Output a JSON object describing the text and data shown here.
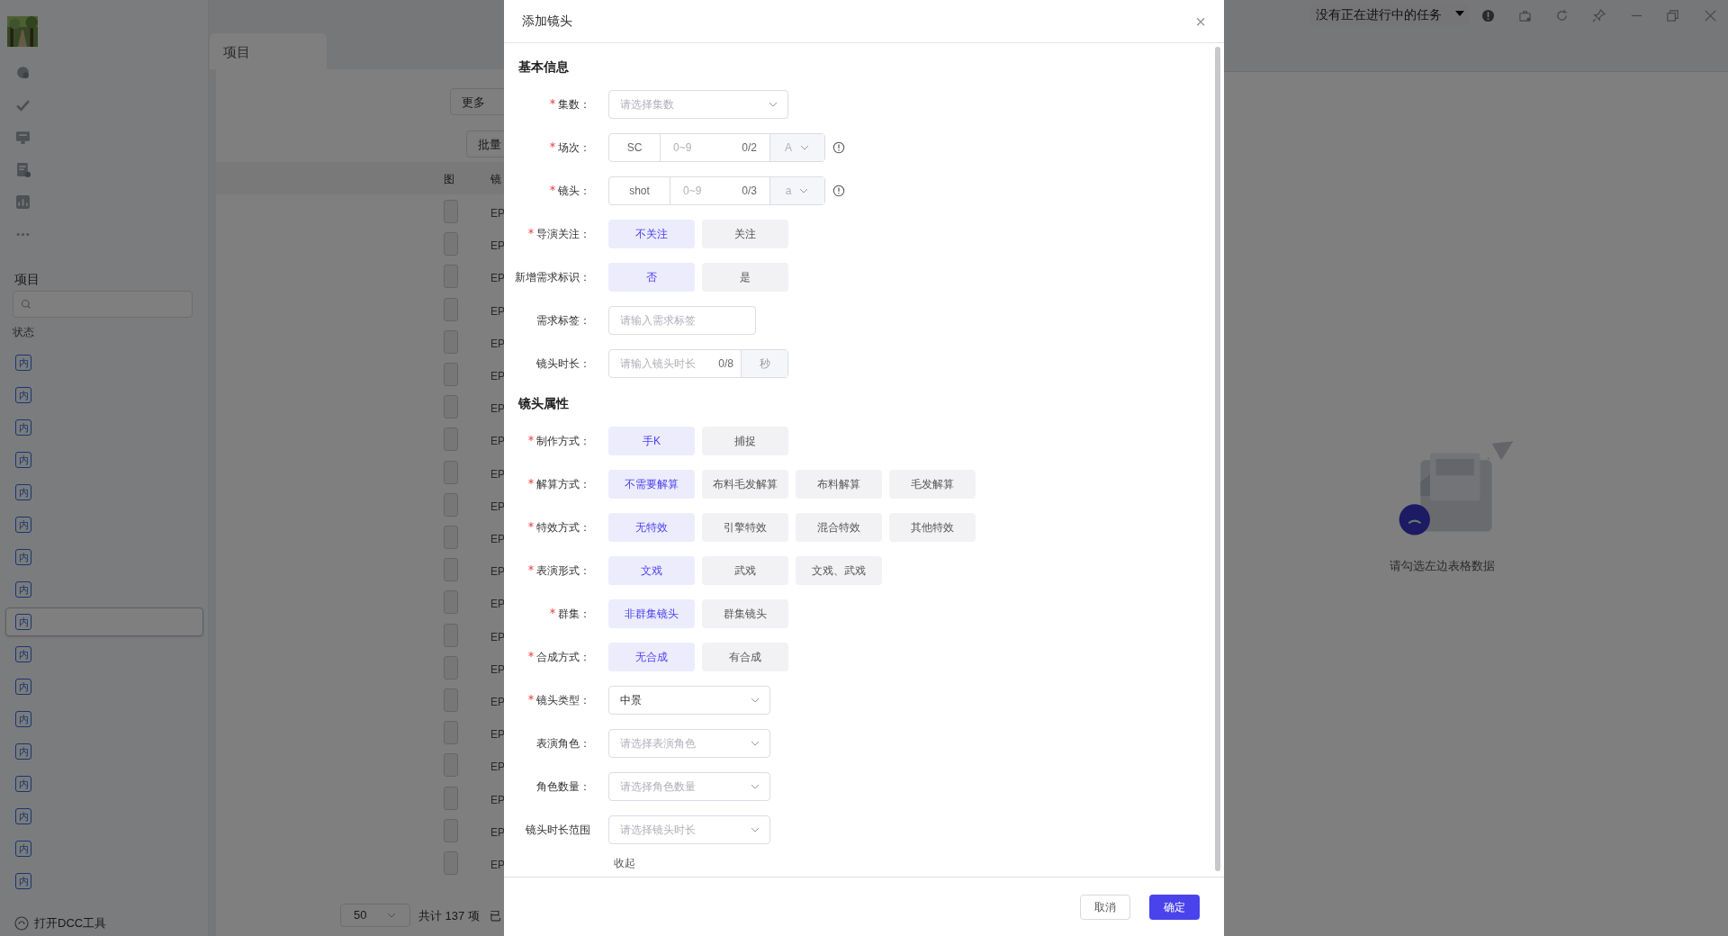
{
  "background": {
    "task_dropdown": "没有正在进行中的任务",
    "sidebar_heading": "项目",
    "filter_label": "状态",
    "status_badges": [
      {
        "label": "内",
        "selected": false
      },
      {
        "label": "内",
        "selected": false
      },
      {
        "label": "内",
        "selected": false
      },
      {
        "label": "内",
        "selected": false
      },
      {
        "label": "内",
        "selected": false
      },
      {
        "label": "内",
        "selected": false
      },
      {
        "label": "内",
        "selected": false
      },
      {
        "label": "内",
        "selected": false
      },
      {
        "label": "内",
        "selected": true
      },
      {
        "label": "内",
        "selected": false
      },
      {
        "label": "内",
        "selected": false
      },
      {
        "label": "内",
        "selected": false
      },
      {
        "label": "内",
        "selected": false
      },
      {
        "label": "内",
        "selected": false
      },
      {
        "label": "内",
        "selected": false
      },
      {
        "label": "内",
        "selected": false
      },
      {
        "label": "内",
        "selected": false
      }
    ],
    "dcc_tool": "打开DCC工具",
    "tab": "项目",
    "more_button": "更多",
    "batch_button": "批量",
    "table": {
      "columns": [
        "图",
        "镜"
      ],
      "rows": [
        "EP",
        "EP",
        "EP",
        "EP",
        "EP",
        "EP",
        "EP",
        "EP",
        "EP",
        "EP",
        "EP",
        "EP",
        "EP",
        "EP",
        "EP",
        "EP",
        "EP",
        "EP",
        "EP",
        "EP",
        "EP"
      ]
    },
    "footer": {
      "page_size": "50",
      "total": "共计 137 项",
      "selected": "已"
    },
    "empty_state": "请勾选左边表格数据"
  },
  "dialog": {
    "title": "添加镜头",
    "close": "×",
    "sections": [
      {
        "heading": "基本信息",
        "fields": [
          {
            "kind": "select",
            "label": "集数：",
            "required": true,
            "placeholder": "请选择集数"
          },
          {
            "kind": "affix",
            "label": "场次：",
            "required": true,
            "prefix": "SC",
            "placeholder": "0~9",
            "count": "0/2",
            "suffix": "A"
          },
          {
            "kind": "affix",
            "label": "镜头：",
            "required": true,
            "prefix": "shot",
            "placeholder": "0~9",
            "count": "0/3",
            "suffix": "a"
          },
          {
            "kind": "choice",
            "label": "导演关注：",
            "required": true,
            "options": [
              {
                "label": "不关注",
                "selected": true
              },
              {
                "label": "关注",
                "selected": false
              }
            ]
          },
          {
            "kind": "choice",
            "label": "新增需求标识：",
            "required": false,
            "options": [
              {
                "label": "否",
                "selected": true
              },
              {
                "label": "是",
                "selected": false
              }
            ]
          },
          {
            "kind": "input",
            "label": "需求标签：",
            "required": false,
            "placeholder": "请输入需求标签"
          },
          {
            "kind": "counted",
            "label": "镜头时长：",
            "required": false,
            "placeholder": "请输入镜头时长",
            "count": "0/8",
            "suffix": "秒"
          }
        ]
      },
      {
        "heading": "镜头属性",
        "fields": [
          {
            "kind": "choice",
            "label": "制作方式：",
            "required": true,
            "options": [
              {
                "label": "手K",
                "selected": true
              },
              {
                "label": "捕捉",
                "selected": false
              }
            ]
          },
          {
            "kind": "choice",
            "label": "解算方式：",
            "required": true,
            "options": [
              {
                "label": "不需要解算",
                "selected": true
              },
              {
                "label": "布料毛发解算",
                "selected": false
              },
              {
                "label": "布料解算",
                "selected": false
              },
              {
                "label": "毛发解算",
                "selected": false
              }
            ]
          },
          {
            "kind": "choice",
            "label": "特效方式：",
            "required": true,
            "options": [
              {
                "label": "无特效",
                "selected": true
              },
              {
                "label": "引擎特效",
                "selected": false
              },
              {
                "label": "混合特效",
                "selected": false
              },
              {
                "label": "其他特效",
                "selected": false
              }
            ]
          },
          {
            "kind": "choice",
            "label": "表演形式：",
            "required": true,
            "options": [
              {
                "label": "文戏",
                "selected": true
              },
              {
                "label": "武戏",
                "selected": false
              },
              {
                "label": "文戏、武戏",
                "selected": false
              }
            ]
          },
          {
            "kind": "choice",
            "label": "群集：",
            "required": true,
            "options": [
              {
                "label": "非群集镜头",
                "selected": true
              },
              {
                "label": "群集镜头",
                "selected": false
              }
            ]
          },
          {
            "kind": "choice",
            "label": "合成方式：",
            "required": true,
            "options": [
              {
                "label": "无合成",
                "selected": true
              },
              {
                "label": "有合成",
                "selected": false
              }
            ]
          },
          {
            "kind": "select",
            "label": "镜头类型：",
            "required": true,
            "value": "中景",
            "narrow": true
          },
          {
            "kind": "select",
            "label": "表演角色：",
            "required": false,
            "placeholder": "请选择表演角色",
            "narrow": true
          },
          {
            "kind": "select",
            "label": "角色数量：",
            "required": false,
            "placeholder": "请选择角色数量",
            "narrow": true
          },
          {
            "kind": "select",
            "label": "镜头时长范围",
            "required": false,
            "placeholder": "请选择镜头时长",
            "narrow": true
          }
        ]
      }
    ],
    "collapse_link": "收起",
    "cancel_button": "取消",
    "ok_button": "确定"
  }
}
